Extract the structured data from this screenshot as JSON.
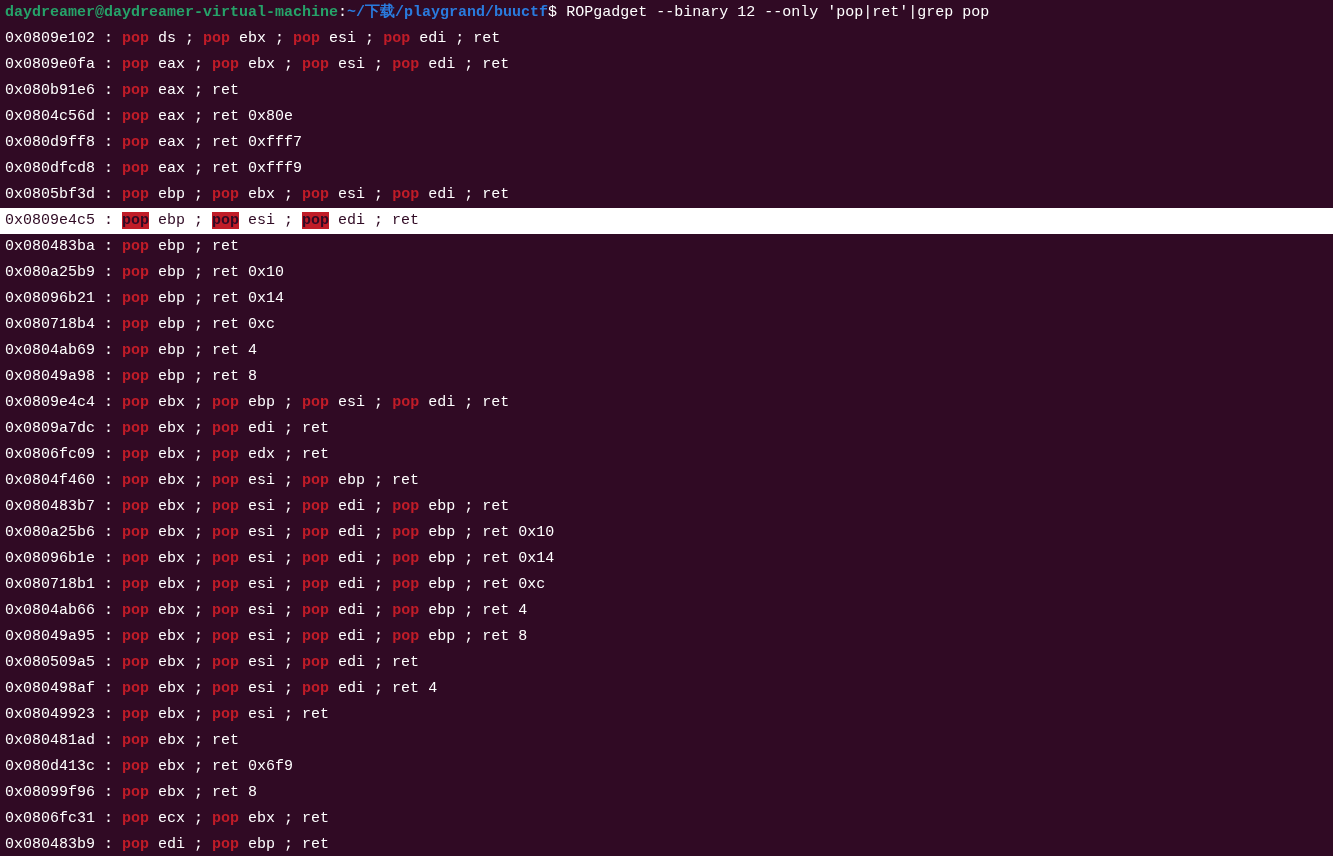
{
  "prompt": {
    "user_host": "daydreamer@daydreamer-virtual-machine",
    "separator": ":",
    "path": "~/下载/playgrand/buuctf",
    "symbol": "$",
    "command": "ROPgadget --binary 12 --only 'pop|ret'|grep pop"
  },
  "lines": [
    {
      "text": "0x0809e102 : **pop** ds ; **pop** ebx ; **pop** esi ; **pop** edi ; ret",
      "selected": false
    },
    {
      "text": "0x0809e0fa : **pop** eax ; **pop** ebx ; **pop** esi ; **pop** edi ; ret",
      "selected": false
    },
    {
      "text": "0x080b91e6 : **pop** eax ; ret",
      "selected": false
    },
    {
      "text": "0x0804c56d : **pop** eax ; ret 0x80e",
      "selected": false
    },
    {
      "text": "0x080d9ff8 : **pop** eax ; ret 0xfff7",
      "selected": false
    },
    {
      "text": "0x080dfcd8 : **pop** eax ; ret 0xfff9",
      "selected": false
    },
    {
      "text": "0x0805bf3d : **pop** ebp ; **pop** ebx ; **pop** esi ; **pop** edi ; ret",
      "selected": false
    },
    {
      "text": "0x0809e4c5 : **pop** ebp ; **pop** esi ; **pop** edi ; ret",
      "selected": true
    },
    {
      "text": "0x080483ba : **pop** ebp ; ret",
      "selected": false
    },
    {
      "text": "0x080a25b9 : **pop** ebp ; ret 0x10",
      "selected": false
    },
    {
      "text": "0x08096b21 : **pop** ebp ; ret 0x14",
      "selected": false
    },
    {
      "text": "0x080718b4 : **pop** ebp ; ret 0xc",
      "selected": false
    },
    {
      "text": "0x0804ab69 : **pop** ebp ; ret 4",
      "selected": false
    },
    {
      "text": "0x08049a98 : **pop** ebp ; ret 8",
      "selected": false
    },
    {
      "text": "0x0809e4c4 : **pop** ebx ; **pop** ebp ; **pop** esi ; **pop** edi ; ret",
      "selected": false
    },
    {
      "text": "0x0809a7dc : **pop** ebx ; **pop** edi ; ret",
      "selected": false
    },
    {
      "text": "0x0806fc09 : **pop** ebx ; **pop** edx ; ret",
      "selected": false
    },
    {
      "text": "0x0804f460 : **pop** ebx ; **pop** esi ; **pop** ebp ; ret",
      "selected": false
    },
    {
      "text": "0x080483b7 : **pop** ebx ; **pop** esi ; **pop** edi ; **pop** ebp ; ret",
      "selected": false
    },
    {
      "text": "0x080a25b6 : **pop** ebx ; **pop** esi ; **pop** edi ; **pop** ebp ; ret 0x10",
      "selected": false
    },
    {
      "text": "0x08096b1e : **pop** ebx ; **pop** esi ; **pop** edi ; **pop** ebp ; ret 0x14",
      "selected": false
    },
    {
      "text": "0x080718b1 : **pop** ebx ; **pop** esi ; **pop** edi ; **pop** ebp ; ret 0xc",
      "selected": false
    },
    {
      "text": "0x0804ab66 : **pop** ebx ; **pop** esi ; **pop** edi ; **pop** ebp ; ret 4",
      "selected": false
    },
    {
      "text": "0x08049a95 : **pop** ebx ; **pop** esi ; **pop** edi ; **pop** ebp ; ret 8",
      "selected": false
    },
    {
      "text": "0x080509a5 : **pop** ebx ; **pop** esi ; **pop** edi ; ret",
      "selected": false
    },
    {
      "text": "0x080498af : **pop** ebx ; **pop** esi ; **pop** edi ; ret 4",
      "selected": false
    },
    {
      "text": "0x08049923 : **pop** ebx ; **pop** esi ; ret",
      "selected": false
    },
    {
      "text": "0x080481ad : **pop** ebx ; ret",
      "selected": false
    },
    {
      "text": "0x080d413c : **pop** ebx ; ret 0x6f9",
      "selected": false
    },
    {
      "text": "0x08099f96 : **pop** ebx ; ret 8",
      "selected": false
    },
    {
      "text": "0x0806fc31 : **pop** ecx ; **pop** ebx ; ret",
      "selected": false
    },
    {
      "text": "0x080483b9 : **pop** edi ; **pop** ebp ; ret",
      "selected": false
    }
  ]
}
